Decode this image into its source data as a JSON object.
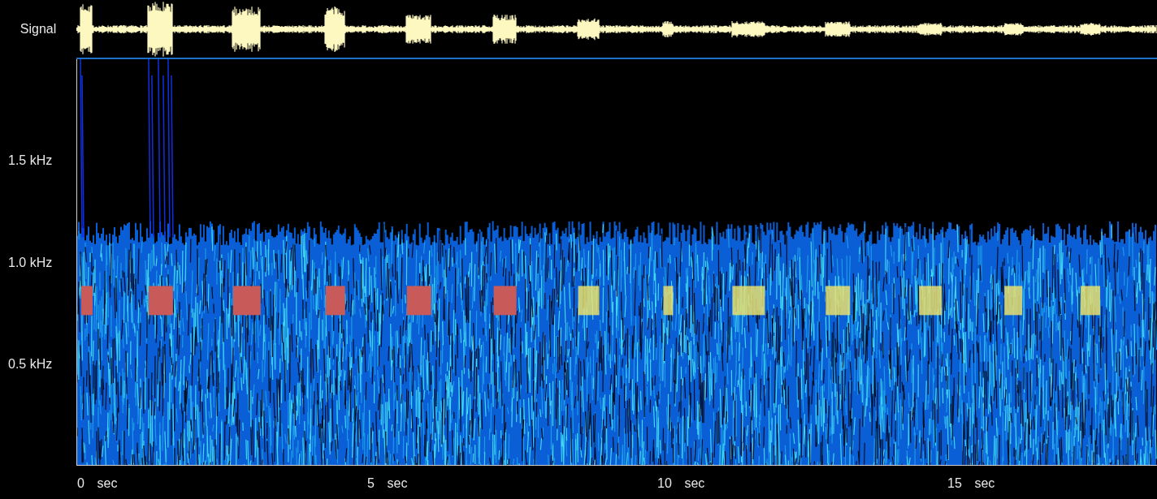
{
  "signal_track": {
    "label": "Signal"
  },
  "frequency_axis": {
    "ticks": [
      "1.5 kHz",
      "1.0 kHz",
      "0.5 kHz"
    ]
  },
  "time_axis": {
    "ticks": [
      "0 sec",
      "5 sec",
      "10 sec",
      "15 sec"
    ]
  }
}
